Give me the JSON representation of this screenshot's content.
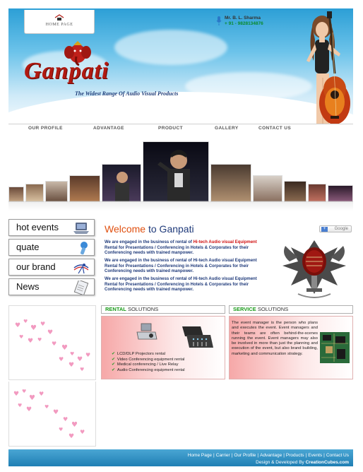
{
  "header": {
    "home_label": "HOME PAGE",
    "contact_name": "Mr. B. L. Sharma",
    "contact_phone": "+ 91 - 9828134876",
    "logo_word": "Ganpati",
    "tagline": "The Widest Range Of Audio Visual Products"
  },
  "nav": {
    "items": [
      "OUR PROFILE",
      "ADVANTAGE",
      "PRODUCT",
      "GALLERY",
      "CONTACT US"
    ]
  },
  "sidebar": {
    "items": [
      {
        "label": "hot events",
        "icon": "laptop-icon"
      },
      {
        "label": "quate",
        "icon": "microphone-icon"
      },
      {
        "label": "our brand",
        "icon": "brand-logo-icon"
      },
      {
        "label": "News",
        "icon": "notepad-icon"
      }
    ]
  },
  "welcome": {
    "title_word1": "Welcome",
    "title_word2": "to Ganpati",
    "google_label": "Google",
    "para_pre": "We are engaged in the business of rental of",
    "para_highlight": "Hi-tech Audio visual Equipment",
    "para_post": "Rental for Presentations / Conferencing in Hotels & Corporates for their Conferencing needs with trained manpower.",
    "para2": "We are engaged in the business of rental of Hi-tech Audio visual Equipment Rental for Presentations / Conferencing in Hotels & Corporates for their Conferencing needs with trained manpower.",
    "para3": "We are engaged in the business of rental of Hi-tech Audio visual Equipment Rental for Presentations / Conferencing in Hotels & Corporates for their Conferencing needs with trained manpower."
  },
  "rental": {
    "heading_green": "RENTAL",
    "heading_rest": "SOLUTIONS",
    "items": [
      "LCD/DLP Projectors rental",
      "Video Conferencing equipment rental",
      "Medical conferencing / Live Relay",
      "Audio Conferencing equipment rental"
    ]
  },
  "service": {
    "heading_green": "SERVICE",
    "heading_rest": "SOLUTIONS",
    "text": "The event manager is the person who plans and executes the event. Event managers and their teams are often behind-the-scenes running the event. Event managers may also be involved in more than just the planning and execution of the event, but also brand building, marketing and communication strategy."
  },
  "footer": {
    "links": [
      "Home Page",
      "Carrier",
      "Our Profile",
      "Advantage",
      "Products",
      "Events",
      "Contact Us"
    ],
    "credit_prefix": "Design & Developed By",
    "credit_brand": "CreationCubes.com"
  },
  "colors": {
    "accent_orange": "#e05010",
    "heading_navy": "#1f3a7a",
    "logo_red": "#b01a12",
    "green": "#1a9a1a",
    "footer_blue": "#1f7fb4"
  }
}
